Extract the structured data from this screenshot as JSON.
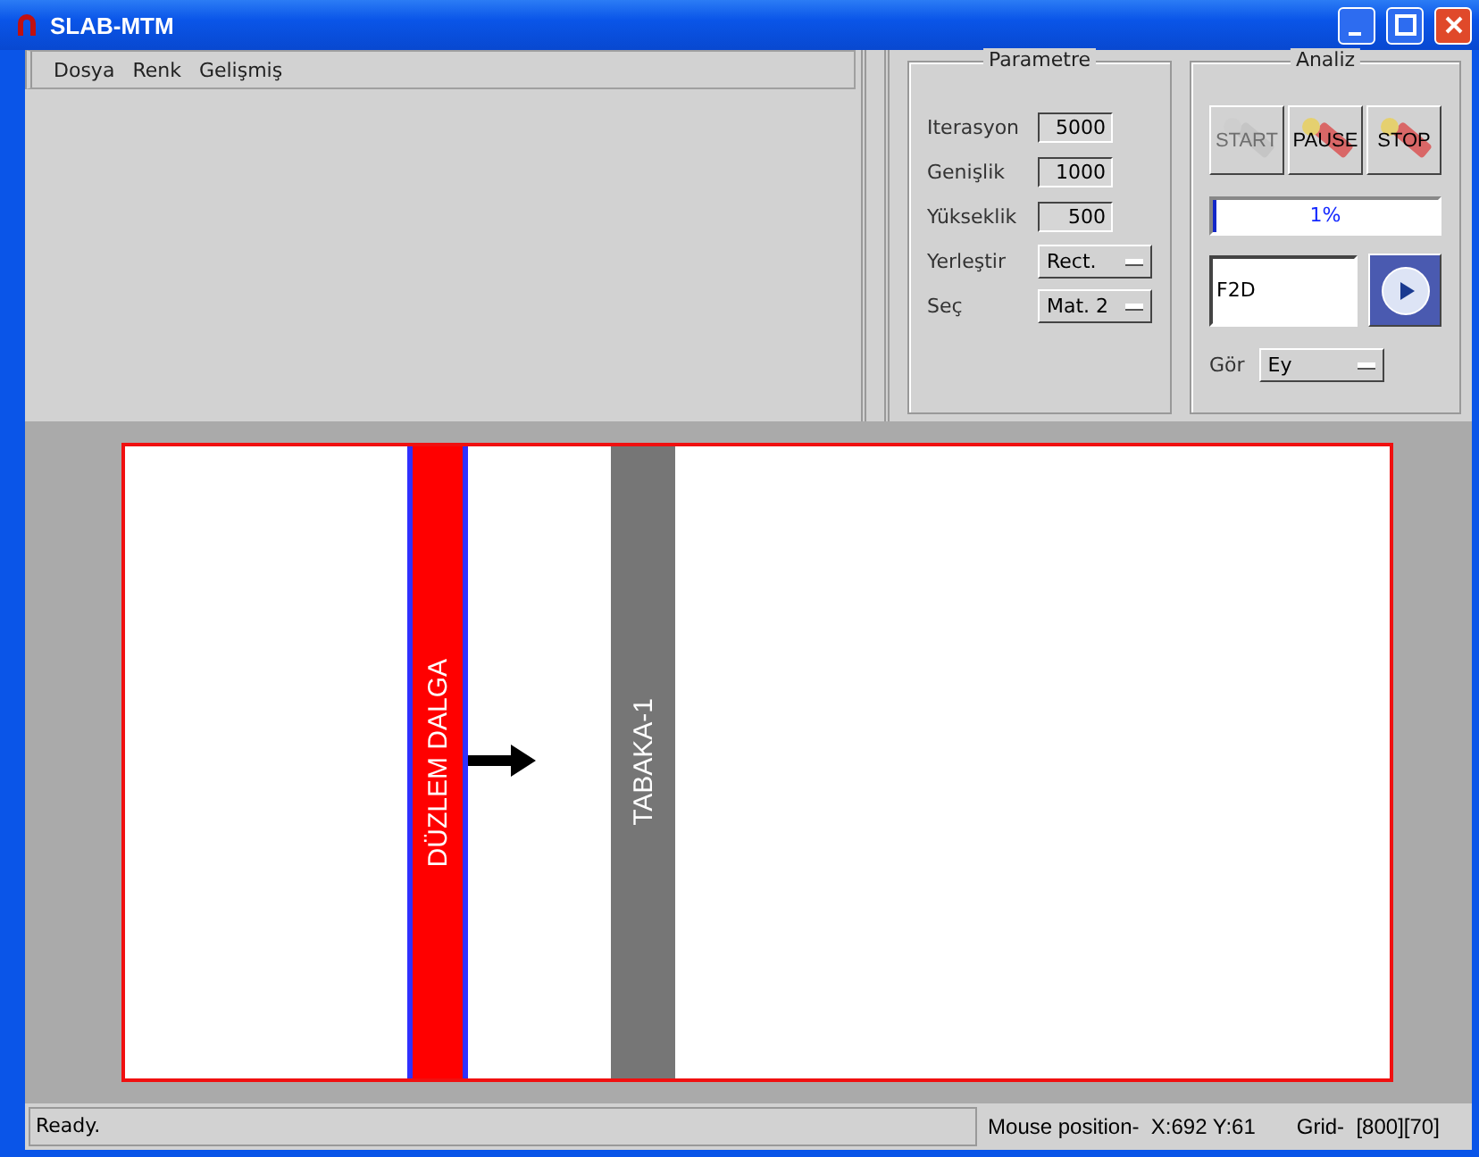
{
  "window": {
    "title": "SLAB-MTM"
  },
  "menu": [
    "Dosya",
    "Renk",
    "Gelişmiş"
  ],
  "parameters": {
    "title": "Parametre",
    "fields": [
      {
        "label": "Iterasyon",
        "value": "5000",
        "kind": "input"
      },
      {
        "label": "Genişlik",
        "value": "1000",
        "kind": "input"
      },
      {
        "label": "Yükseklik",
        "value": "500",
        "kind": "input"
      },
      {
        "label": "Yerleştir",
        "value": "Rect.",
        "kind": "select"
      },
      {
        "label": "Seç",
        "value": "Mat. 2",
        "kind": "select"
      }
    ]
  },
  "analysis": {
    "title": "Analiz",
    "buttons": [
      {
        "label": "START",
        "disabled": true
      },
      {
        "label": "PAUSE",
        "disabled": false
      },
      {
        "label": "STOP",
        "disabled": false
      }
    ],
    "progress": {
      "level": 0.01,
      "reading": "1%"
    },
    "function_field": {
      "value": "F2D"
    },
    "view": {
      "label": "Gör",
      "value": "Ey"
    }
  },
  "canvas": {
    "layers": [
      {
        "label": "DÜZLEM DALGA",
        "kind": "source"
      },
      {
        "label": "TABAKA-1",
        "kind": "slab"
      }
    ]
  },
  "status_bar": {
    "message": "Ready.",
    "mouse": "Mouse position-  X:692 Y:61",
    "grid": "Grid-  [800][70]"
  }
}
